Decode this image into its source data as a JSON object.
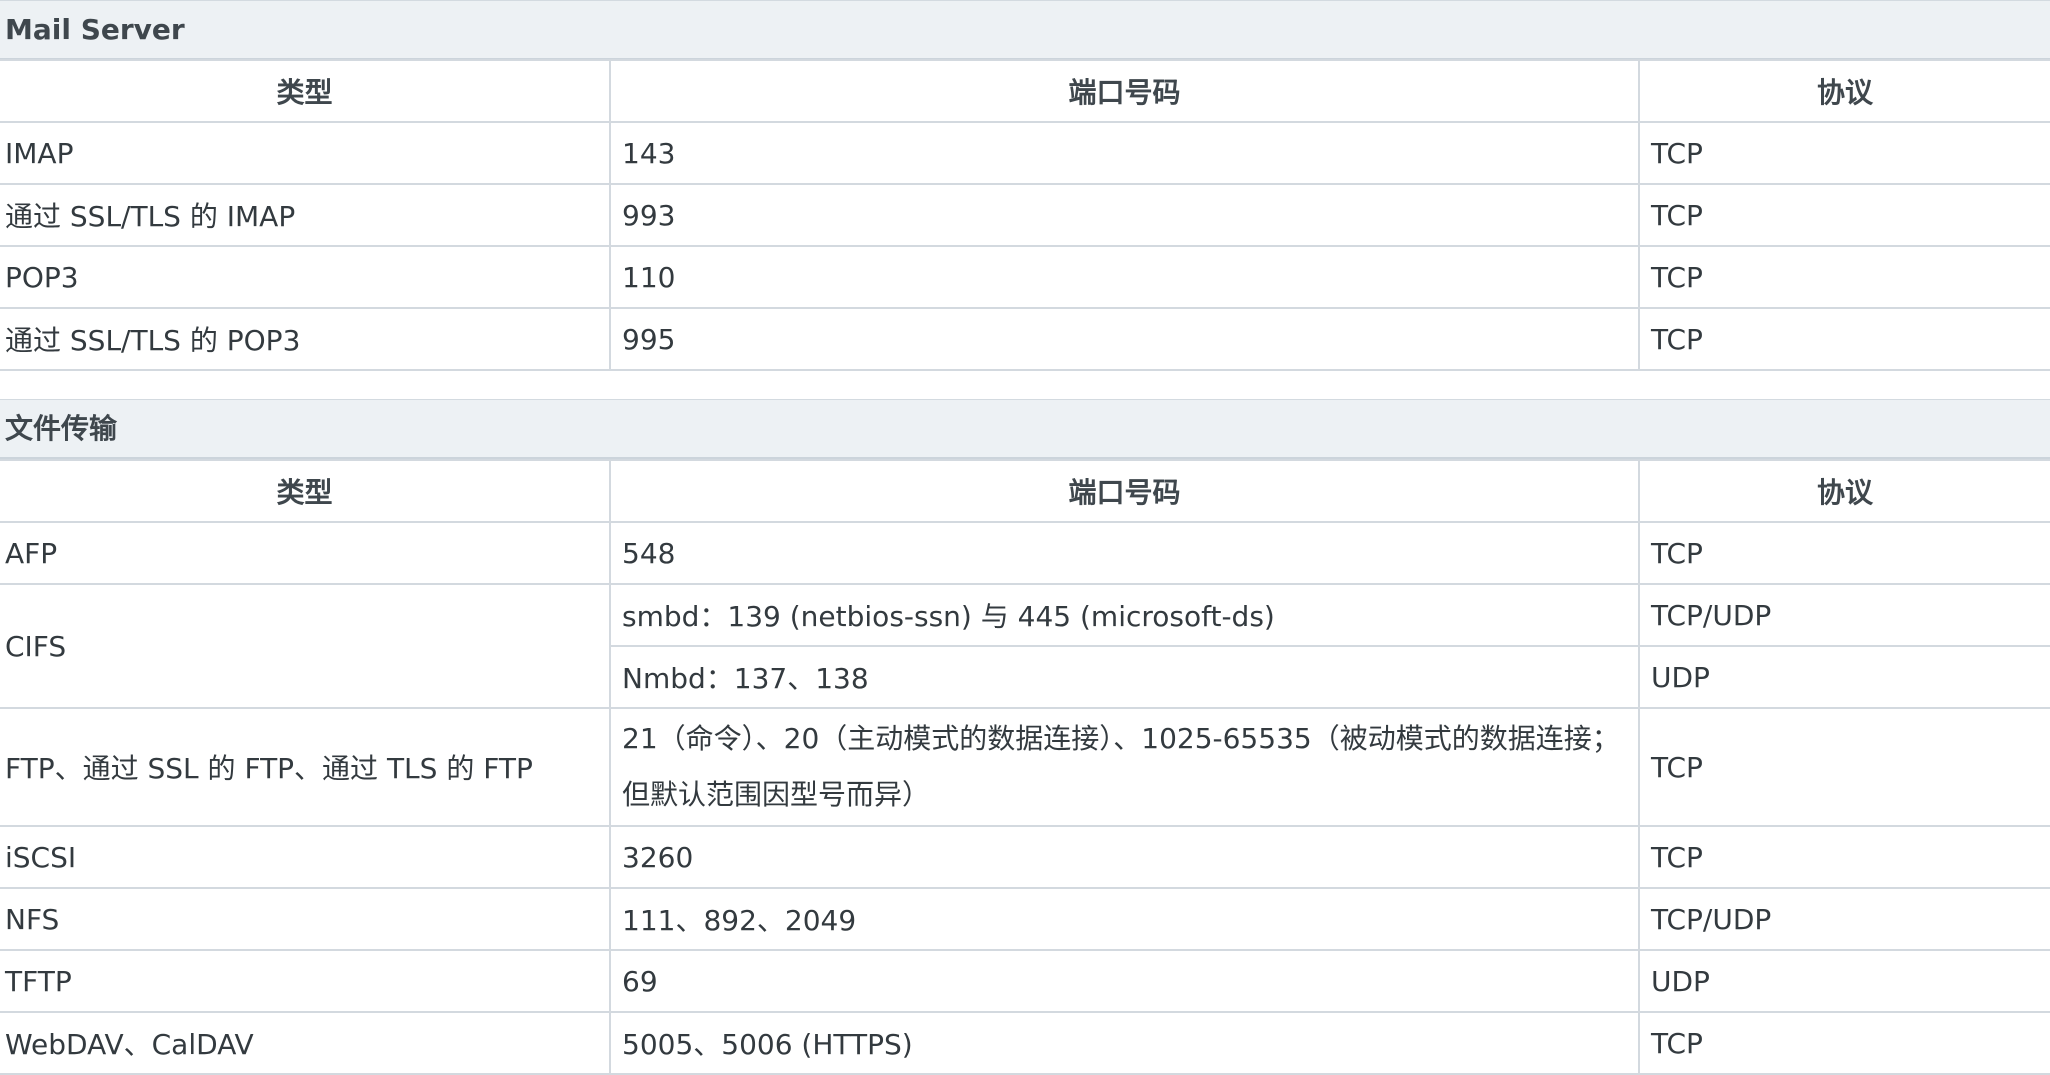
{
  "sections": {
    "mail": {
      "title": "Mail Server",
      "headers": [
        "类型",
        "端口号码",
        "协议"
      ],
      "rows": [
        [
          "IMAP",
          "143",
          "TCP"
        ],
        [
          "通过 SSL/TLS 的 IMAP",
          "993",
          "TCP"
        ],
        [
          "POP3",
          "110",
          "TCP"
        ],
        [
          "通过 SSL/TLS 的 POP3",
          "995",
          "TCP"
        ]
      ]
    },
    "file_transfer": {
      "title": "文件传输",
      "headers": [
        "类型",
        "端口号码",
        "协议"
      ],
      "rows": [
        {
          "type": "AFP",
          "port": "548",
          "protocol": "TCP"
        },
        {
          "type": "CIFS",
          "port": "smbd：139 (netbios-ssn) 与 445 (microsoft-ds)",
          "protocol": "TCP/UDP"
        },
        {
          "port": "Nmbd：137、138",
          "protocol": "UDP"
        },
        {
          "type": "FTP、通过 SSL 的 FTP、通过 TLS 的 FTP",
          "port": "21（命令）、20（主动模式的数据连接）、1025-65535（被动模式的数据连接；但默认范围因型号而异）",
          "protocol": "TCP"
        },
        {
          "type": "iSCSI",
          "port": "3260",
          "protocol": "TCP"
        },
        {
          "type": "NFS",
          "port": "111、892、2049",
          "protocol": "TCP/UDP"
        },
        {
          "type": "TFTP",
          "port": "69",
          "protocol": "UDP"
        },
        {
          "type": "WebDAV、CalDAV",
          "port": "5005、5006 (HTTPS)",
          "protocol": "TCP"
        }
      ]
    }
  }
}
